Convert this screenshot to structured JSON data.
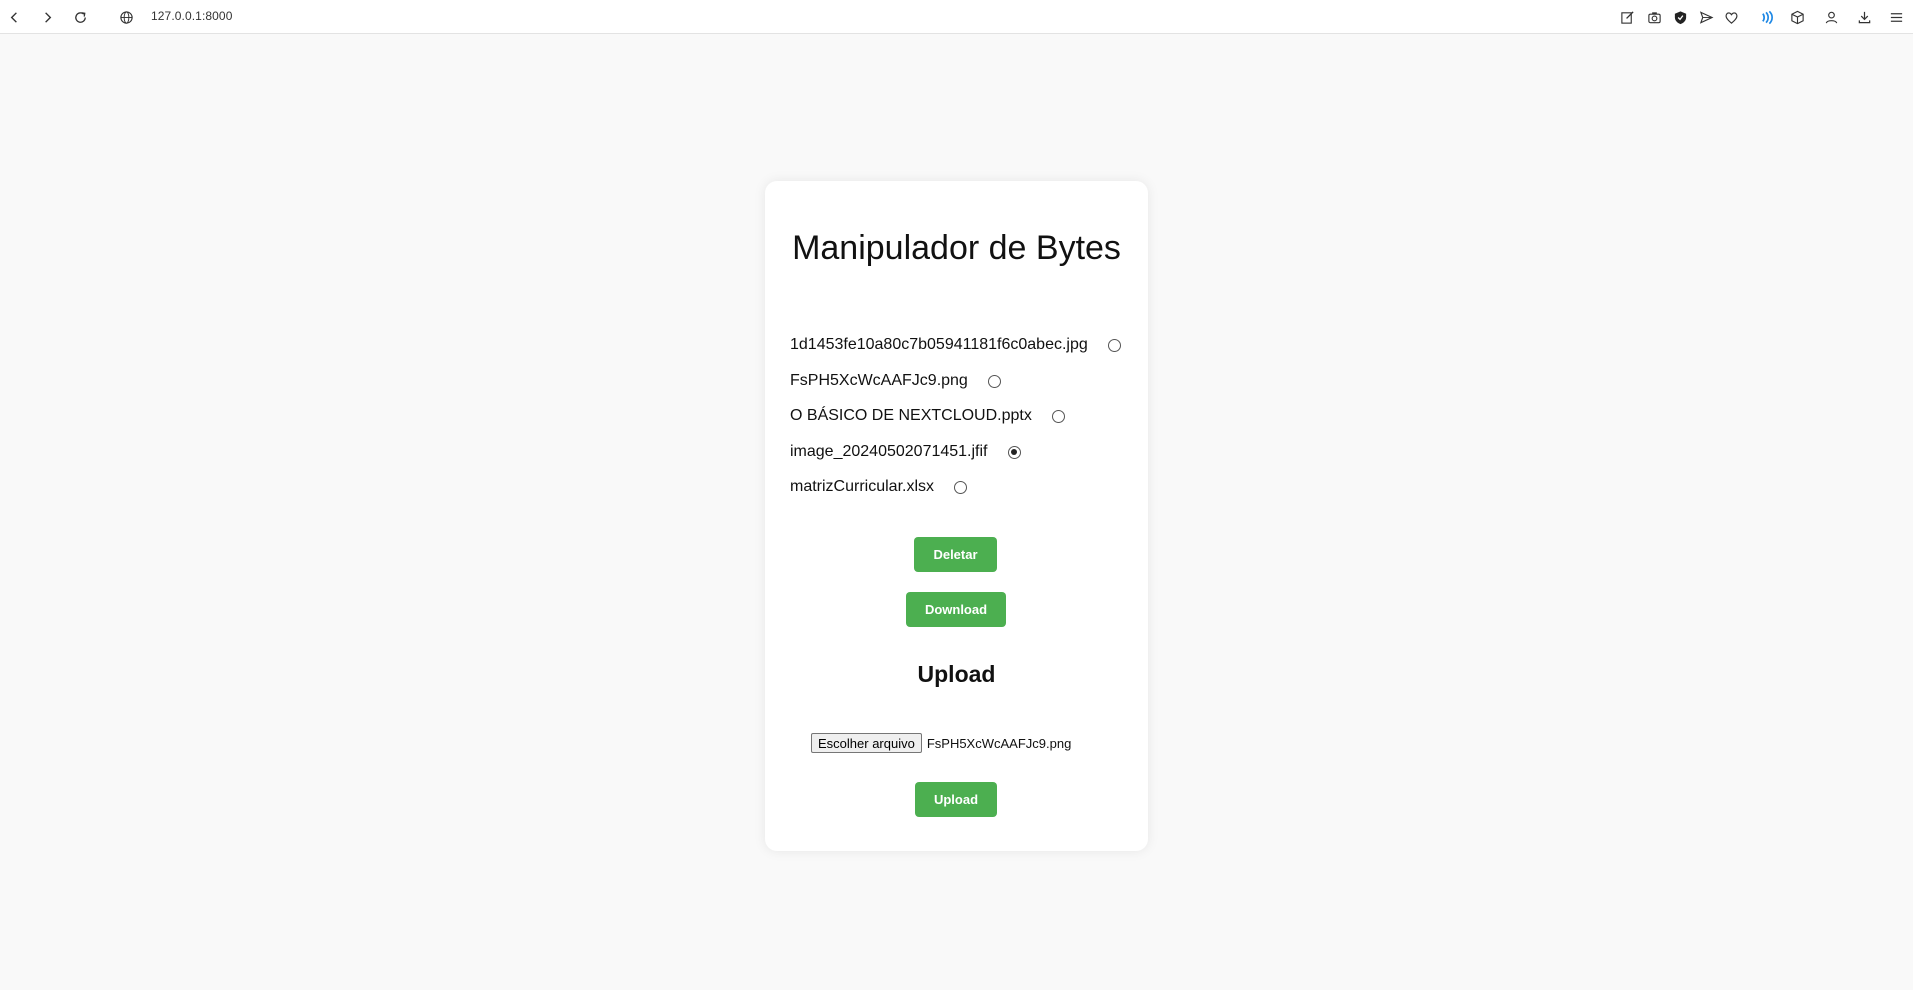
{
  "browser": {
    "url": "127.0.0.1:8000",
    "icons": [
      "back-icon",
      "forward-icon",
      "reload-icon",
      "globe-icon",
      "edit-icon",
      "camera-icon",
      "shield-icon",
      "send-icon",
      "heart-icon",
      "wave-icon",
      "cube-icon",
      "profile-icon",
      "download-icon",
      "menu-icon"
    ]
  },
  "page": {
    "title": "Manipulador de Bytes",
    "files": [
      {
        "name": "1d1453fe10a80c7b05941181f6c0abec.jpg",
        "selected": false
      },
      {
        "name": "FsPH5XcWcAAFJc9.png",
        "selected": false
      },
      {
        "name": "O BÁSICO DE NEXTCLOUD.pptx",
        "selected": false
      },
      {
        "name": "image_20240502071451.jfif",
        "selected": true
      },
      {
        "name": "matrizCurricular.xlsx",
        "selected": false
      }
    ],
    "delete_label": "Deletar",
    "download_label": "Download",
    "upload_heading": "Upload",
    "choose_file_label": "Escolher arquivo",
    "chosen_file": "FsPH5XcWcAAFJc9.png",
    "upload_label": "Upload",
    "accent_color": "#4caf50"
  }
}
